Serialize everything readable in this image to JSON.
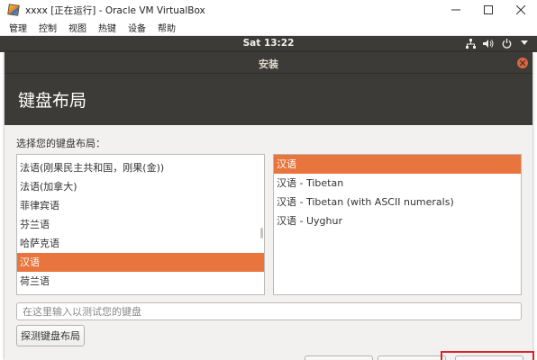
{
  "vbox": {
    "title": "xxxx [正在运行] - Oracle VM VirtualBox",
    "menu": [
      "管理",
      "控制",
      "视图",
      "热键",
      "设备",
      "帮助"
    ]
  },
  "guest_panel": {
    "clock": "Sat 13:22",
    "indicators": [
      "network-icon",
      "volume-icon",
      "power-icon",
      "dropdown-arrow-icon"
    ]
  },
  "installer": {
    "window_title": "安装",
    "page_title": "键盘布局",
    "prompt": "选择您的键盘布局：",
    "layouts": [
      {
        "label": "法语(刚果民主共和国，刚果(金))",
        "selected": false
      },
      {
        "label": "法语(加拿大)",
        "selected": false
      },
      {
        "label": "菲律宾语",
        "selected": false
      },
      {
        "label": "芬兰语",
        "selected": false
      },
      {
        "label": "哈萨克语",
        "selected": false
      },
      {
        "label": "汉语",
        "selected": true
      },
      {
        "label": "荷兰语",
        "selected": false
      }
    ],
    "variants": [
      {
        "label": "汉语",
        "selected": true
      },
      {
        "label": "汉语 - Tibetan",
        "selected": false
      },
      {
        "label": "汉语 - Tibetan (with ASCII numerals)",
        "selected": false
      },
      {
        "label": "汉语 - Uyghur",
        "selected": false
      }
    ],
    "test_placeholder": "在这里输入以测试您的键盘",
    "detect_button": "探测键盘布局"
  },
  "colors": {
    "accent": "#e9753e",
    "panel_bg": "#3c3b37",
    "body_bg": "#f2f1f0",
    "highlight": "#d9252a"
  }
}
